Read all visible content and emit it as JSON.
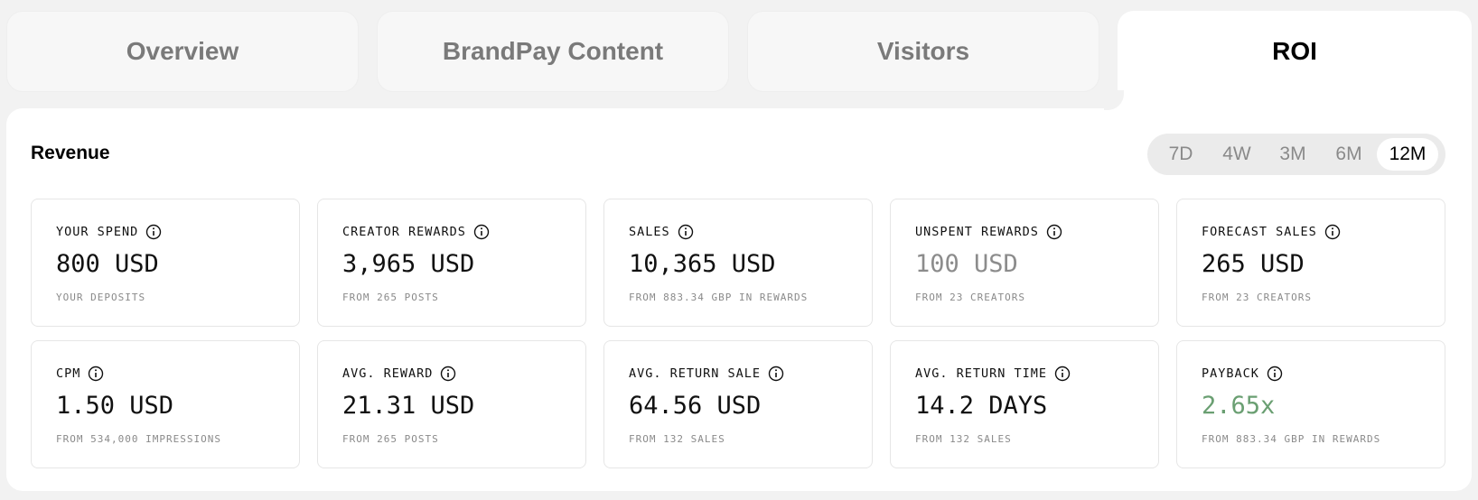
{
  "tabs": [
    {
      "label": "Overview"
    },
    {
      "label": "BrandPay Content"
    },
    {
      "label": "Visitors"
    },
    {
      "label": "ROI"
    }
  ],
  "section": {
    "title": "Revenue"
  },
  "range": {
    "options": [
      "7D",
      "4W",
      "3M",
      "6M",
      "12M"
    ],
    "selected": "12M"
  },
  "cards": [
    {
      "label": "YOUR SPEND",
      "value": "800 USD",
      "sub": "YOUR DEPOSITS"
    },
    {
      "label": "CREATOR REWARDS",
      "value": "3,965 USD",
      "sub": "FROM 265 POSTS"
    },
    {
      "label": "SALES",
      "value": "10,365 USD",
      "sub": "FROM 883.34 GBP IN REWARDS"
    },
    {
      "label": "UNSPENT REWARDS",
      "value": "100 USD",
      "sub": "FROM 23 CREATORS"
    },
    {
      "label": "FORECAST SALES",
      "value": "265 USD",
      "sub": "FROM 23 CREATORS"
    },
    {
      "label": "CPM",
      "value": "1.50 USD",
      "sub": "FROM 534,000 IMPRESSIONS"
    },
    {
      "label": "AVG. REWARD",
      "value": "21.31 USD",
      "sub": "FROM 265 POSTS"
    },
    {
      "label": "AVG. RETURN SALE",
      "value": "64.56 USD",
      "sub": "FROM 132 SALES"
    },
    {
      "label": "AVG. RETURN TIME",
      "value": "14.2 DAYS",
      "sub": "FROM 132 SALES"
    },
    {
      "label": "PAYBACK",
      "value": "2.65x",
      "sub": "FROM 883.34 GBP IN REWARDS"
    }
  ],
  "colors": {
    "muted_value": "#8c8c8c",
    "positive_value": "#6a9f72",
    "background": "#f2f2f2",
    "panel": "#ffffff"
  },
  "icons": {
    "info": "info-circle-icon"
  }
}
